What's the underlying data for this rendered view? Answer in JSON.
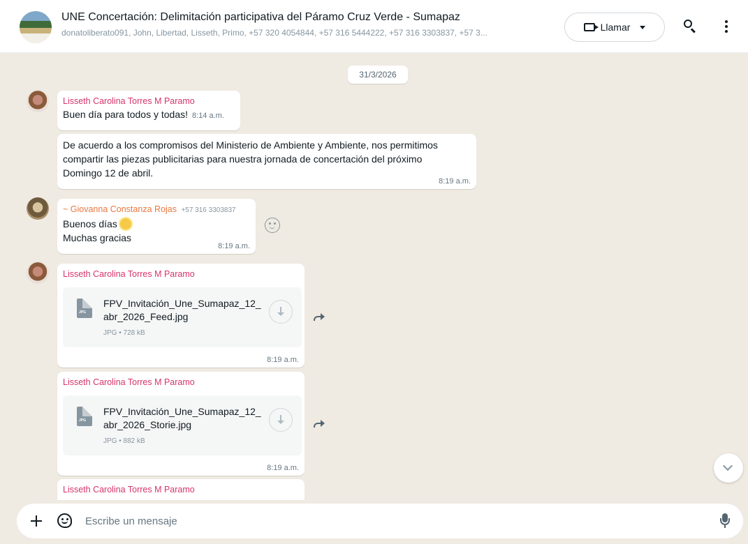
{
  "header": {
    "title": "UNE  Concertación: Delimitación participativa del Páramo Cruz Verde - Sumapaz",
    "members": "donatoliberato091, John, Libertad, Lisseth, Primo, +57 320 4054844, +57 316 5444222, +57 316 3303837, +57 3...",
    "call_label": "Llamar"
  },
  "chat": {
    "date": "31/3/2026",
    "messages": [
      {
        "sender": "Lisseth Carolina Torres M Paramo",
        "sender_color": "#d6336c",
        "text": "Buen día para todos y todas!",
        "time": "8:14 a.m."
      },
      {
        "text": "De acuerdo a los compromisos del Ministerio de Ambiente y Ambiente, nos permitimos compartir las piezas publicitarias para nuestra jornada de concertación del próximo Domingo 12 de abril.",
        "time": "8:19 a.m."
      },
      {
        "sender": "~ Giovanna Constanza Rojas",
        "sender_phone": "+57 316 3303837",
        "sender_color": "#e8773f",
        "line1": "Buenos días",
        "line2": "Muchas gracias",
        "time": "8:19 a.m."
      },
      {
        "sender": "Lisseth Carolina Torres M Paramo",
        "file_name": "FPV_Invitación_Une_Sumapaz_12_abr_2026_Feed.jpg",
        "file_meta": "JPG • 728 kB",
        "file_ext": "JPG",
        "time": "8:19 a.m."
      },
      {
        "sender": "Lisseth Carolina Torres M Paramo",
        "file_name": "FPV_Invitación_Une_Sumapaz_12_abr_2026_Storie.jpg",
        "file_meta": "JPG • 882 kB",
        "file_ext": "JPG",
        "time": "8:19 a.m."
      },
      {
        "sender": "Lisseth Carolina Torres M Paramo"
      }
    ]
  },
  "composer": {
    "placeholder": "Escribe un mensaje"
  },
  "colors": {
    "chat_background": "#efeae2",
    "bubble": "#ffffff",
    "lisseth_name": "#d6336c",
    "giovanna_name": "#e8773f"
  },
  "icons": [
    "group-avatar",
    "video-camera-icon",
    "chevron-down-icon",
    "search-icon",
    "menu-icon",
    "emoji-reaction-icon",
    "document-icon",
    "download-icon",
    "forward-icon",
    "scroll-down-icon",
    "plus-icon",
    "sticker-icon",
    "mic-icon"
  ]
}
